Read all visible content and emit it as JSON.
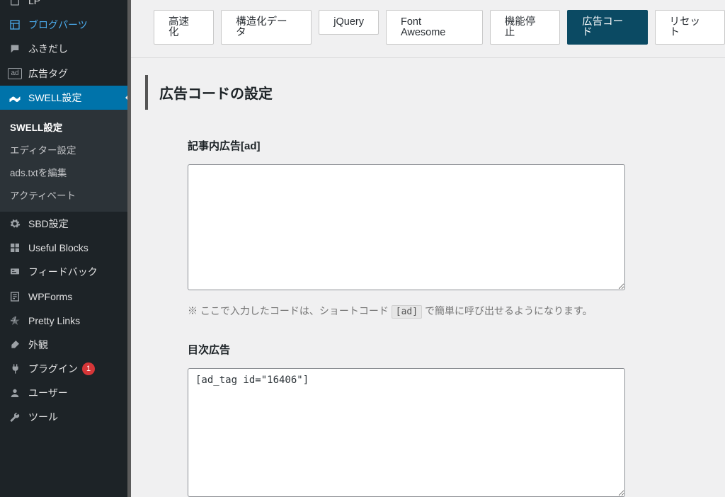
{
  "sidebar": {
    "items": [
      {
        "label": "LP",
        "icon": "page"
      },
      {
        "label": "ブログパーツ",
        "icon": "layout",
        "highlight": true
      },
      {
        "label": "ふきだし",
        "icon": "speech"
      },
      {
        "label": "広告タグ",
        "icon": "ad"
      },
      {
        "label": "SWELL設定",
        "icon": "swell",
        "current": true
      }
    ],
    "submenu": [
      {
        "label": "SWELL設定",
        "current": true
      },
      {
        "label": "エディター設定"
      },
      {
        "label": "ads.txtを編集"
      },
      {
        "label": "アクティベート"
      }
    ],
    "after": [
      {
        "label": "SBD設定",
        "icon": "gear"
      },
      {
        "label": "Useful Blocks",
        "icon": "grid"
      },
      {
        "label": "フィードバック",
        "icon": "feedback"
      },
      {
        "label": "WPForms",
        "icon": "form"
      },
      {
        "label": "Pretty Links",
        "icon": "star"
      },
      {
        "label": "外観",
        "icon": "brush"
      },
      {
        "label": "プラグイン",
        "icon": "plug",
        "badge": "1"
      },
      {
        "label": "ユーザー",
        "icon": "user"
      },
      {
        "label": "ツール",
        "icon": "wrench"
      }
    ]
  },
  "tabs": [
    {
      "label": "高速化"
    },
    {
      "label": "構造化データ"
    },
    {
      "label": "jQuery"
    },
    {
      "label": "Font Awesome"
    },
    {
      "label": "機能停止"
    },
    {
      "label": "広告コード",
      "active": true
    },
    {
      "label": "リセット"
    }
  ],
  "page": {
    "section_title": "広告コードの設定",
    "field1_label": "記事内広告[ad]",
    "field1_value": "",
    "helper_before": "※ ここで入力したコードは、ショートコード",
    "helper_code": "[ad]",
    "helper_after": "で簡単に呼び出せるようになります。",
    "field2_label": "目次広告",
    "field2_value": "[ad_tag id=\"16406\"]"
  }
}
